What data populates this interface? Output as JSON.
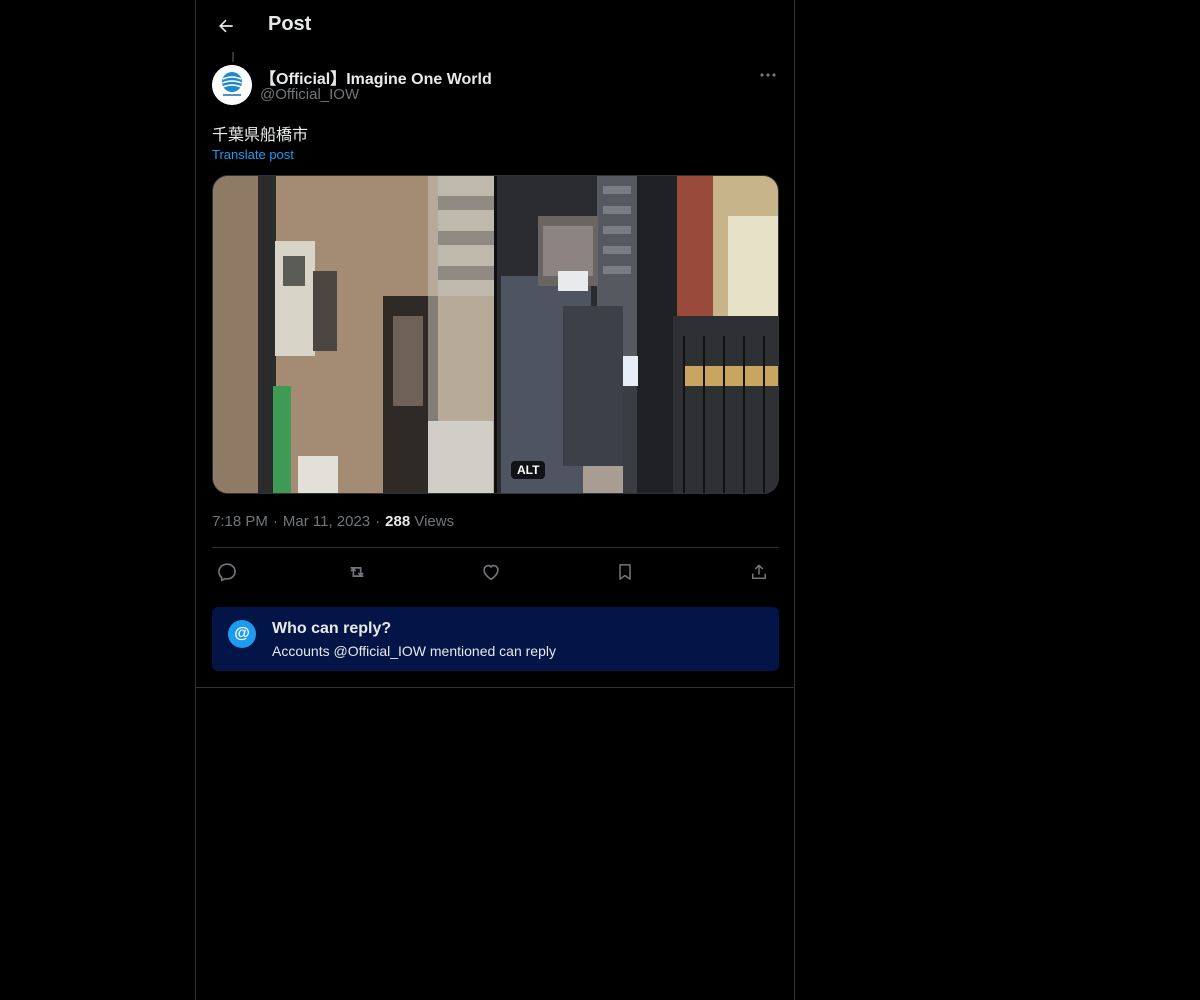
{
  "header": {
    "title": "Post"
  },
  "post": {
    "author": {
      "name": "【Official】Imagine One World",
      "handle": "@Official_IOW"
    },
    "text": "千葉県船橋市",
    "translate_label": "Translate post",
    "media": {
      "alt_badge": "ALT"
    },
    "meta": {
      "time": "7:18 PM",
      "separator": "·",
      "date": "Mar 11, 2023",
      "views_count": "288",
      "views_label": "Views"
    }
  },
  "actions": {
    "reply": "reply-icon",
    "repost": "repost-icon",
    "like": "like-icon",
    "bookmark": "bookmark-icon",
    "share": "share-icon"
  },
  "who_can_reply": {
    "icon": "@",
    "title": "Who can reply?",
    "description": "Accounts @Official_IOW mentioned can reply"
  },
  "colors": {
    "background": "#000000",
    "accent": "#1d9bf0",
    "text_primary": "#e7e9ea",
    "text_secondary": "#71767b",
    "reply_box": "#031547",
    "border": "#2f3336"
  }
}
